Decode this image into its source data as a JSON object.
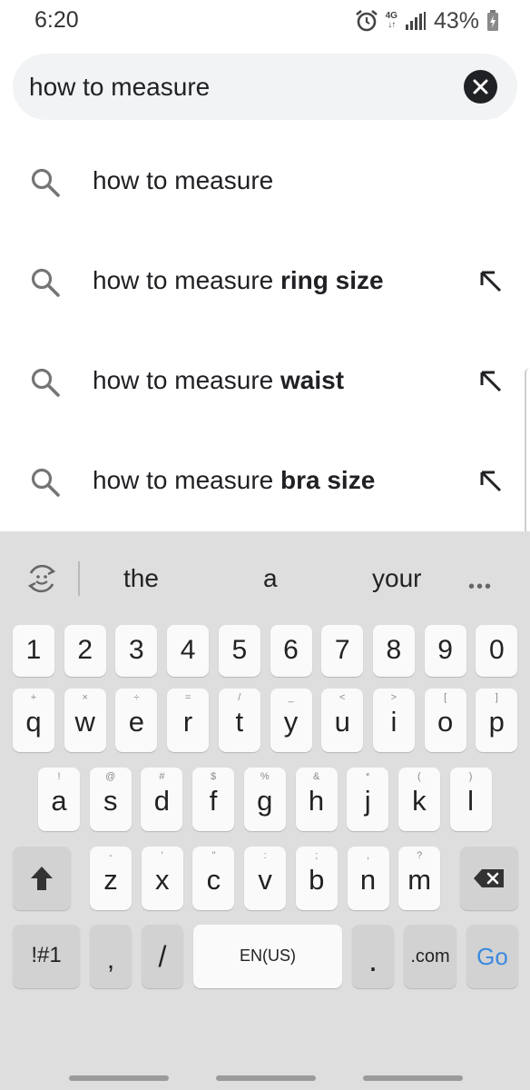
{
  "status_bar": {
    "time": "6:20",
    "network_type": "4G",
    "network_arrows": "↓↑",
    "battery_percent": "43%"
  },
  "search": {
    "query": "how to measure",
    "clear_icon": "close-icon"
  },
  "suggestions": [
    {
      "prefix": "how to measure",
      "bold": "",
      "has_fill": false
    },
    {
      "prefix": "how to measure ",
      "bold": "ring size",
      "has_fill": true
    },
    {
      "prefix": "how to measure ",
      "bold": "waist",
      "has_fill": true
    },
    {
      "prefix": "how to measure ",
      "bold": "bra size",
      "has_fill": true
    }
  ],
  "keyboard": {
    "predictions": [
      "the",
      "a",
      "your"
    ],
    "more_label": "•••",
    "number_row": [
      "1",
      "2",
      "3",
      "4",
      "5",
      "6",
      "7",
      "8",
      "9",
      "0"
    ],
    "row1": [
      {
        "k": "q",
        "h": "+"
      },
      {
        "k": "w",
        "h": "×"
      },
      {
        "k": "e",
        "h": "÷"
      },
      {
        "k": "r",
        "h": "="
      },
      {
        "k": "t",
        "h": "/"
      },
      {
        "k": "y",
        "h": "_"
      },
      {
        "k": "u",
        "h": "<"
      },
      {
        "k": "i",
        "h": ">"
      },
      {
        "k": "o",
        "h": "["
      },
      {
        "k": "p",
        "h": "]"
      }
    ],
    "row2": [
      {
        "k": "a",
        "h": "!"
      },
      {
        "k": "s",
        "h": "@"
      },
      {
        "k": "d",
        "h": "#"
      },
      {
        "k": "f",
        "h": "$"
      },
      {
        "k": "g",
        "h": "%"
      },
      {
        "k": "h",
        "h": "&"
      },
      {
        "k": "j",
        "h": "*"
      },
      {
        "k": "k",
        "h": "("
      },
      {
        "k": "l",
        "h": ")"
      }
    ],
    "row3": [
      {
        "k": "z",
        "h": "-"
      },
      {
        "k": "x",
        "h": "'"
      },
      {
        "k": "c",
        "h": "\""
      },
      {
        "k": "v",
        "h": ":"
      },
      {
        "k": "b",
        "h": ";"
      },
      {
        "k": "n",
        "h": ","
      },
      {
        "k": "m",
        "h": "?"
      }
    ],
    "symbols_label": "!#1",
    "comma_label": ",",
    "slash_label": "/",
    "space_label": "EN(US)",
    "period_label": ".",
    "dotcom_label": ".com",
    "go_label": "Go",
    "accent_color": "#3b8ae0"
  }
}
